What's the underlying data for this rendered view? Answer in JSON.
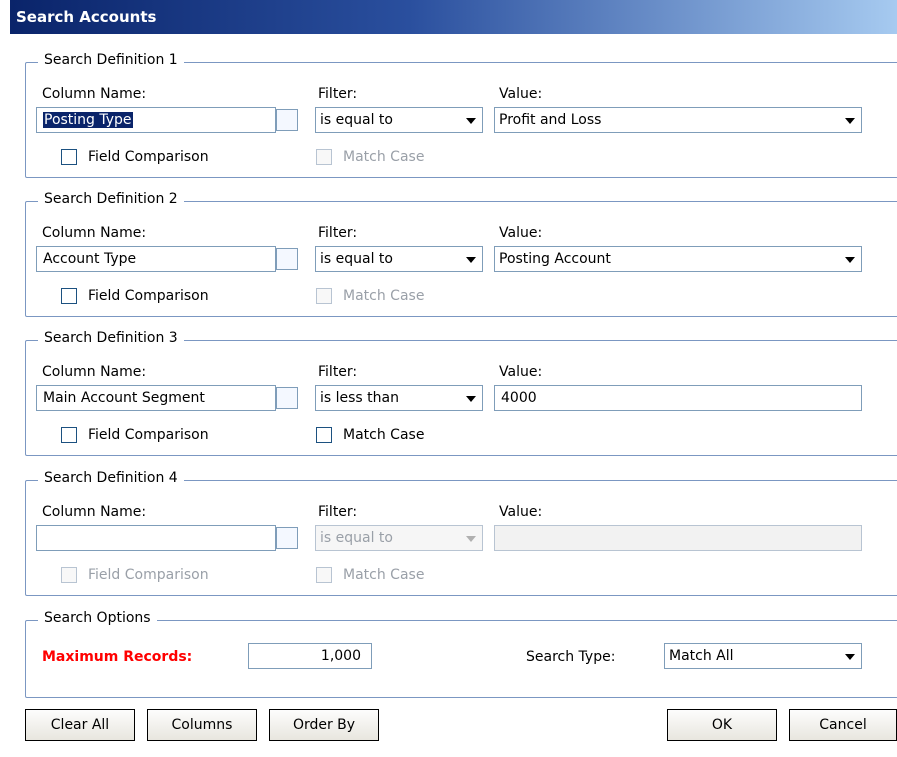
{
  "window": {
    "title": "Search Accounts"
  },
  "labels": {
    "column_name": "Column Name:",
    "filter": "Filter:",
    "value": "Value:",
    "field_comparison": "Field Comparison",
    "match_case": "Match Case"
  },
  "definitions": [
    {
      "title": "Search Definition 1",
      "column": "Posting Type",
      "filter": "is equal to",
      "value": "Profit and Loss"
    },
    {
      "title": "Search Definition 2",
      "column": "Account Type",
      "filter": "is equal to",
      "value": "Posting Account"
    },
    {
      "title": "Search Definition 3",
      "column": "Main Account Segment",
      "filter": "is less than",
      "value": "4000"
    },
    {
      "title": "Search Definition 4",
      "column": "",
      "filter": "is equal to",
      "value": ""
    }
  ],
  "options": {
    "title": "Search Options",
    "max_records_label": "Maximum Records:",
    "max_records": "1,000",
    "search_type_label": "Search Type:",
    "search_type": "Match All",
    "accent_color": "#ff0000"
  },
  "buttons": {
    "clear_all": "Clear All",
    "columns": "Columns",
    "order_by": "Order By",
    "ok": "OK",
    "cancel": "Cancel"
  }
}
